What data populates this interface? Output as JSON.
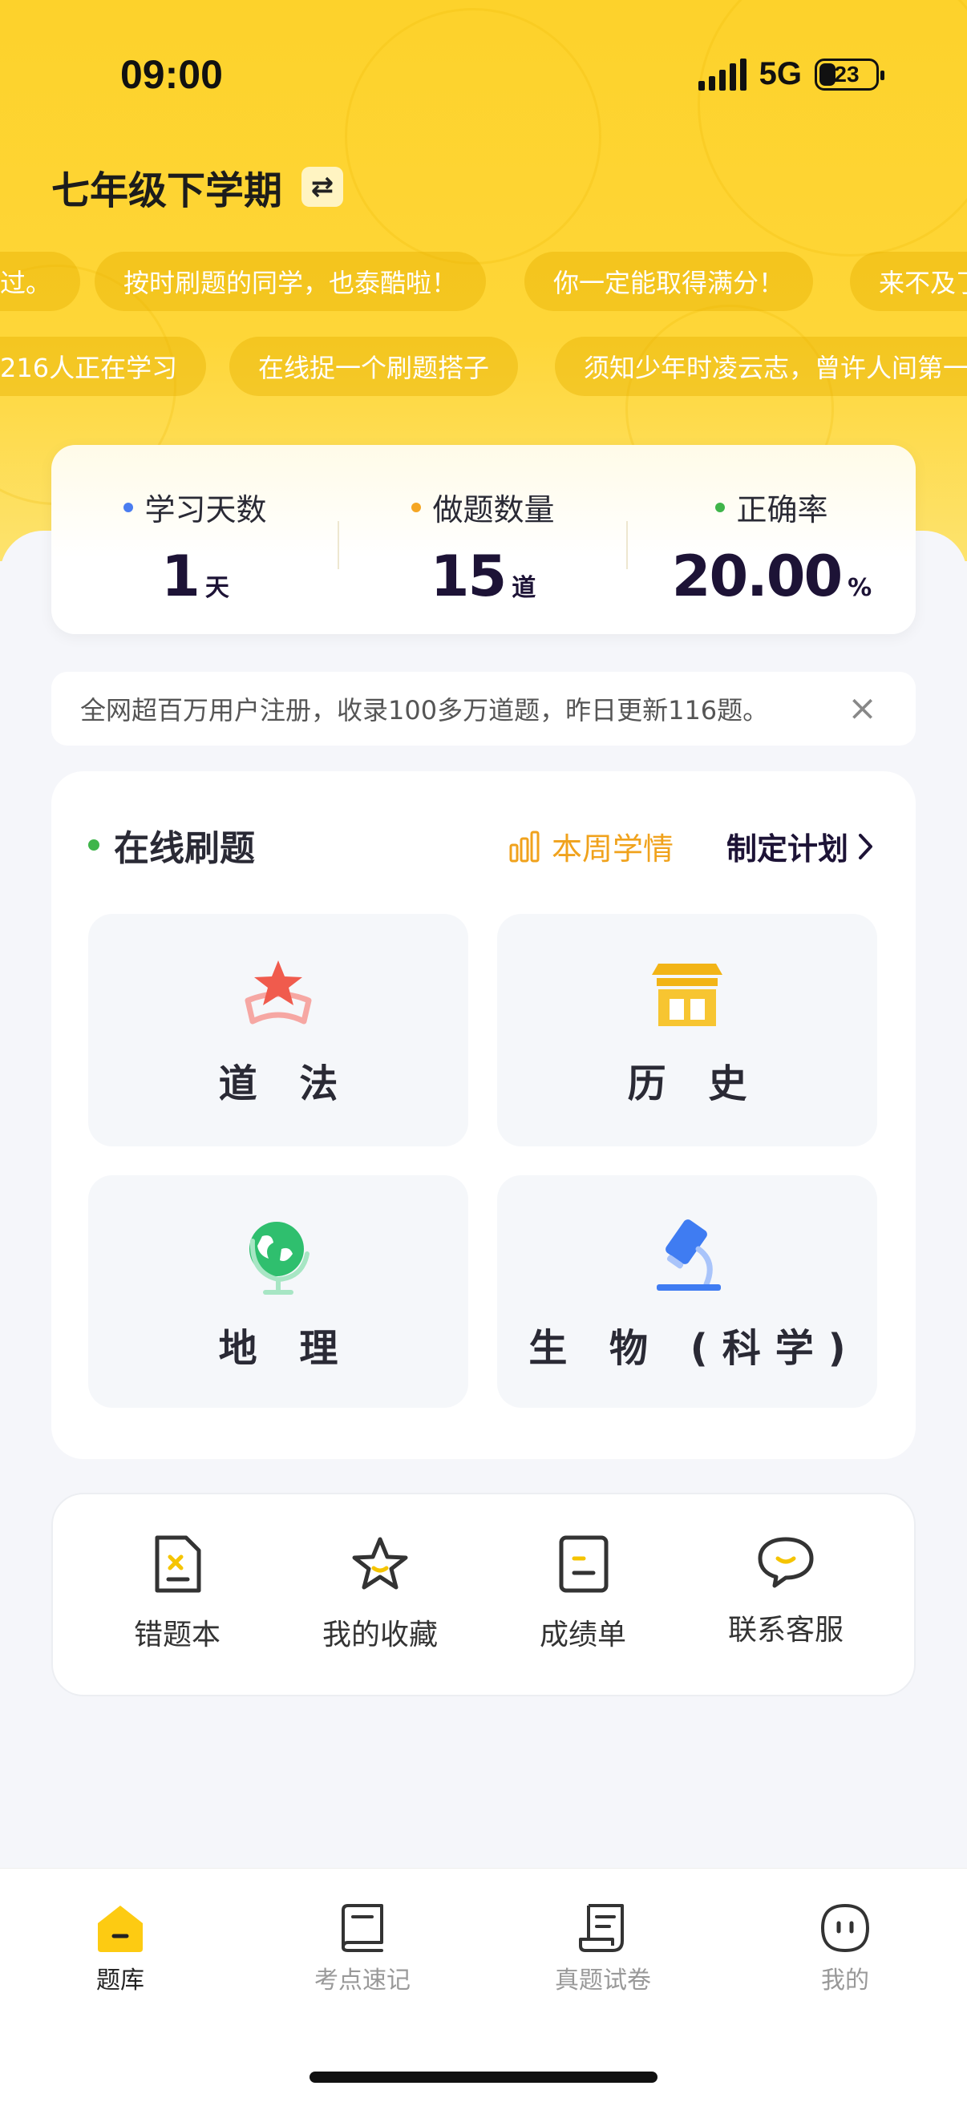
{
  "status_bar": {
    "time": "09:00",
    "network": "5G",
    "battery": "23"
  },
  "header": {
    "grade_title": "七年级下学期",
    "switch_glyph": "⇄"
  },
  "marquee": {
    "row1": [
      "过。",
      "按时刷题的同学，也泰酷啦！",
      "你一定能取得满分！",
      "来不及了"
    ],
    "row2": [
      "216人正在学习",
      "在线捉一个刷题搭子",
      "须知少年时凌云志，曾许人间第一"
    ]
  },
  "stats": {
    "study_days": {
      "label": "学习天数",
      "value": "1",
      "unit": "天",
      "dot_color": "#4a7cf0"
    },
    "question_count": {
      "label": "做题数量",
      "value": "15",
      "unit": "道",
      "dot_color": "#f5a623"
    },
    "accuracy": {
      "label": "正确率",
      "value": "20.00",
      "unit": "%",
      "dot_color": "#3fb54a"
    }
  },
  "notice": {
    "text": "全网超百万用户注册，收录100多万道题，昨日更新116题。",
    "close": "×"
  },
  "practice": {
    "title": "在线刷题",
    "weekly_label": "本周学情",
    "plan_label": "制定计划",
    "subjects": [
      {
        "label": "道 法",
        "icon": "star-badge-icon"
      },
      {
        "label": "历 史",
        "icon": "building-icon"
      },
      {
        "label": "地 理",
        "icon": "globe-icon"
      },
      {
        "label": "生 物 (科学)",
        "icon": "microscope-icon"
      }
    ]
  },
  "tools": [
    {
      "label": "错题本",
      "icon": "mistake-book-icon"
    },
    {
      "label": "我的收藏",
      "icon": "star-icon"
    },
    {
      "label": "成绩单",
      "icon": "report-card-icon"
    },
    {
      "label": "联系客服",
      "icon": "chat-bubble-icon"
    }
  ],
  "tabbar": [
    {
      "label": "题库",
      "icon": "home-icon",
      "active": true
    },
    {
      "label": "考点速记",
      "icon": "book-icon",
      "active": false
    },
    {
      "label": "真题试卷",
      "icon": "scroll-icon",
      "active": false
    },
    {
      "label": "我的",
      "icon": "profile-icon",
      "active": false
    }
  ],
  "colors": {
    "brand_yellow": "#fdd22b",
    "accent_orange": "#f0a21c",
    "navy": "#1d1336"
  }
}
